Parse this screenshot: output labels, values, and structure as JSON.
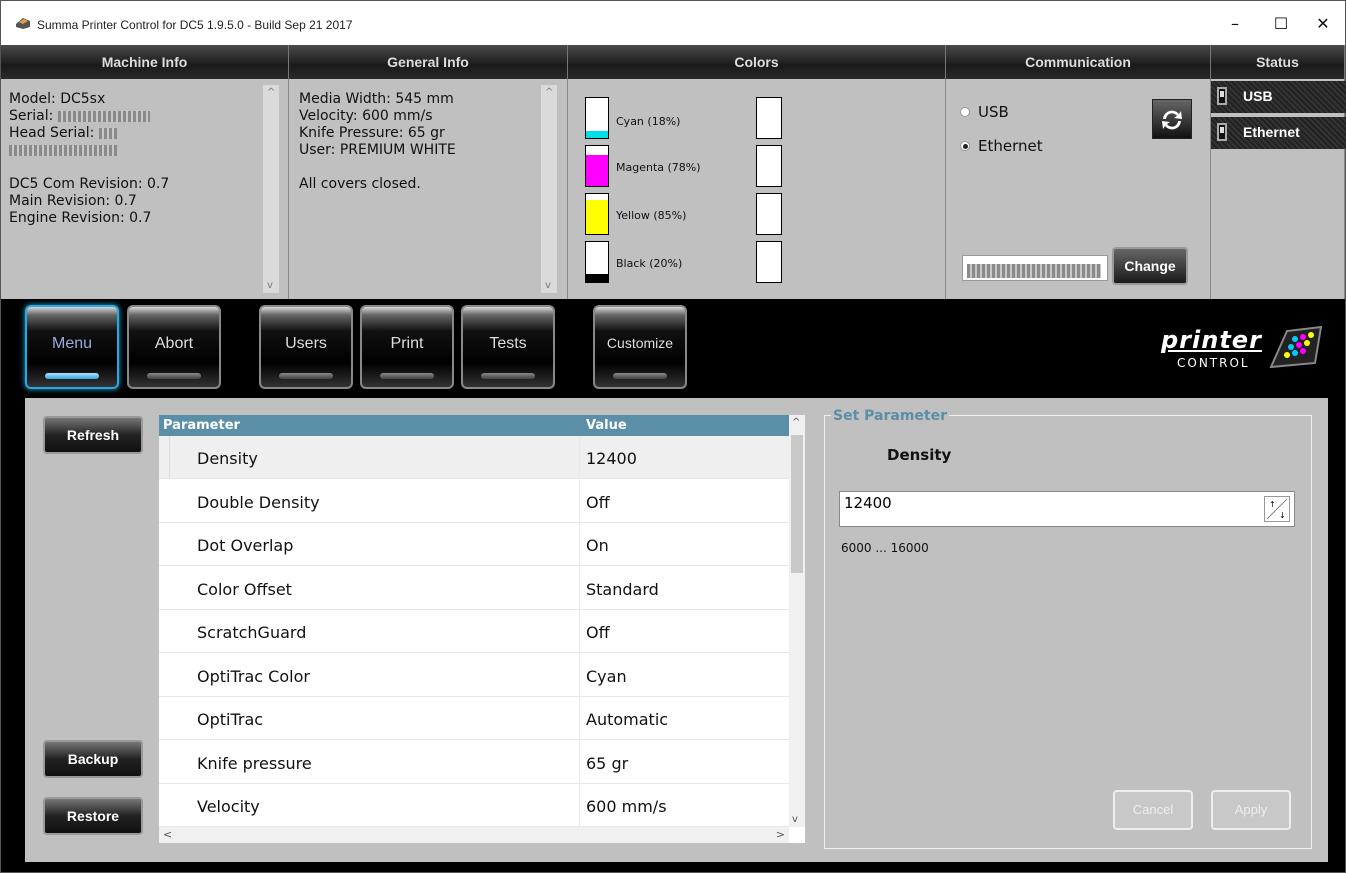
{
  "window": {
    "title": "Summa Printer Control for DC5 1.9.5.0 - Build Sep 21 2017",
    "minimize": "–",
    "maximize": "☐",
    "close": "✕"
  },
  "headers": {
    "machine_info": "Machine Info",
    "general_info": "General Info",
    "colors": "Colors",
    "communication": "Communication",
    "status": "Status"
  },
  "machine_info": {
    "model": "Model: DC5sx",
    "serial_label": "Serial:",
    "head_serial_label": "Head Serial:",
    "com_revision": "DC5 Com Revision: 0.7",
    "main_revision": "Main Revision: 0.7",
    "engine_revision": "Engine Revision: 0.7"
  },
  "general_info": {
    "media_width": "Media Width: 545 mm",
    "velocity": "Velocity: 600 mm/s",
    "knife_pressure": "Knife Pressure: 65 gr",
    "user": "User: PREMIUM WHITE",
    "covers": "All covers closed."
  },
  "colors": {
    "inks": [
      {
        "label": "Cyan (18%)",
        "level": 0.18,
        "color": "#00e0e8"
      },
      {
        "label": "Magenta (78%)",
        "level": 0.78,
        "color": "#ff00ff"
      },
      {
        "label": "Yellow (85%)",
        "level": 0.85,
        "color": "#ffff00"
      },
      {
        "label": "Black (20%)",
        "level": 0.2,
        "color": "#000000"
      }
    ]
  },
  "communication": {
    "usb": "USB",
    "ethernet": "Ethernet",
    "selected": "Ethernet",
    "change": "Change"
  },
  "status": {
    "usb": "USB",
    "ethernet": "Ethernet"
  },
  "nav": {
    "menu": "Menu",
    "abort": "Abort",
    "users": "Users",
    "print": "Print",
    "tests": "Tests",
    "customize": "Customize"
  },
  "logo": {
    "top": "printer",
    "bottom": "CONTROL"
  },
  "side_buttons": {
    "refresh": "Refresh",
    "backup": "Backup",
    "restore": "Restore"
  },
  "table": {
    "col_parameter": "Parameter",
    "col_value": "Value",
    "rows": [
      {
        "parameter": "Density",
        "value": "12400"
      },
      {
        "parameter": "Double Density",
        "value": "Off"
      },
      {
        "parameter": "Dot Overlap",
        "value": "On"
      },
      {
        "parameter": "Color Offset",
        "value": "Standard"
      },
      {
        "parameter": "ScratchGuard",
        "value": "Off"
      },
      {
        "parameter": "OptiTrac Color",
        "value": "Cyan"
      },
      {
        "parameter": "OptiTrac",
        "value": "Automatic"
      },
      {
        "parameter": "Knife pressure",
        "value": "65 gr"
      },
      {
        "parameter": "Velocity",
        "value": "600 mm/s"
      }
    ]
  },
  "set_parameter": {
    "legend": "Set Parameter",
    "name": "Density",
    "value": "12400",
    "range": "6000 ... 16000",
    "cancel": "Cancel",
    "apply": "Apply"
  }
}
